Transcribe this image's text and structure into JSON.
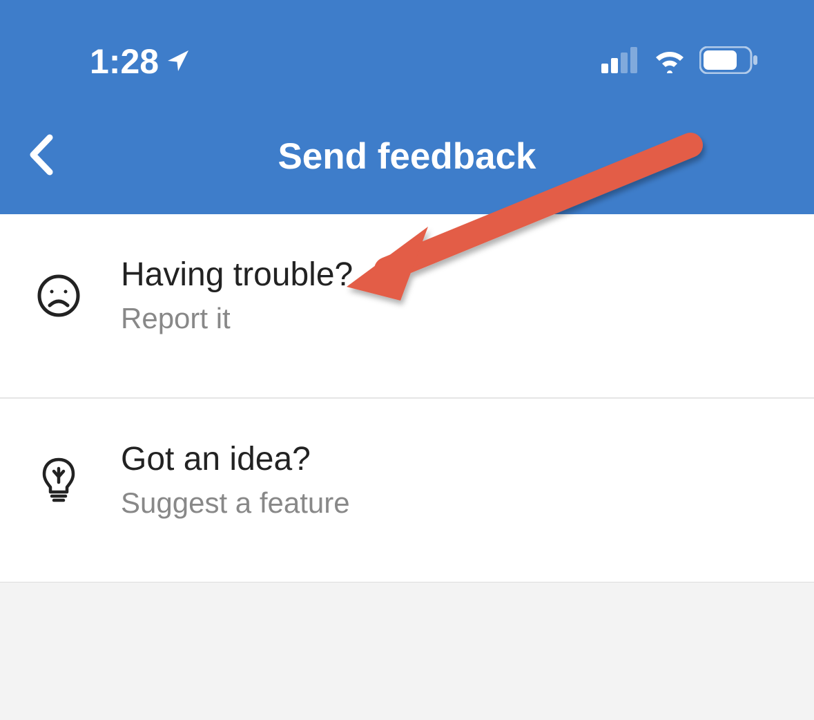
{
  "status_bar": {
    "time": "1:28"
  },
  "nav": {
    "title": "Send feedback"
  },
  "options": [
    {
      "title": "Having trouble?",
      "subtitle": "Report it"
    },
    {
      "title": "Got an idea?",
      "subtitle": "Suggest a feature"
    }
  ]
}
